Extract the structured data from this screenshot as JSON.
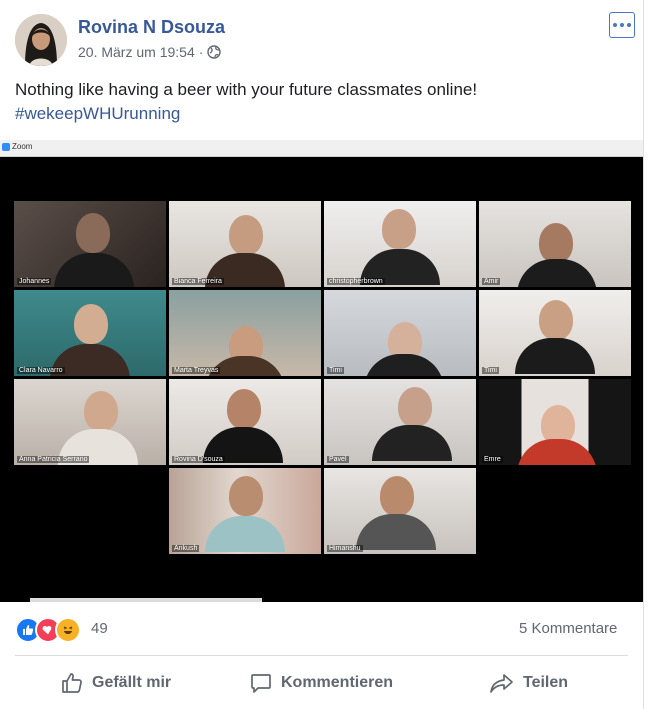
{
  "post": {
    "author": "Rovina N Dsouza",
    "timestamp": "20. März um 19:54",
    "separator": "·",
    "text": "Nothing like having a beer with your future classmates online!",
    "hashtag": "#wekeepWHUrunning"
  },
  "zoom_window": {
    "title": "Zoom",
    "participants": [
      {
        "name": "Johannes"
      },
      {
        "name": "Bianca Ferreira"
      },
      {
        "name": "christopherbrown"
      },
      {
        "name": "Amir"
      },
      {
        "name": "Clara Navarro"
      },
      {
        "name": "Marta Treyvas"
      },
      {
        "name": "Timi"
      },
      {
        "name": "Timi"
      },
      {
        "name": "Anna Patricia Serrano"
      },
      {
        "name": "Rovina D'souza"
      },
      {
        "name": "Pavel"
      },
      {
        "name": "Emre"
      },
      {
        "name": "Ankush"
      },
      {
        "name": "Himanshu"
      }
    ]
  },
  "engagement": {
    "reaction_count": "49",
    "comments_label": "5 Kommentare",
    "reactions": [
      "like-icon",
      "love-icon",
      "haha-icon"
    ]
  },
  "actions": {
    "like": "Gefällt mir",
    "comment": "Kommentieren",
    "share": "Teilen"
  },
  "colors": {
    "link": "#385898",
    "like_blue": "#1877f2",
    "love_red": "#f33e58",
    "haha_yellow": "#f7b125",
    "muted": "#606770",
    "active_speaker": "#c4e05a"
  }
}
